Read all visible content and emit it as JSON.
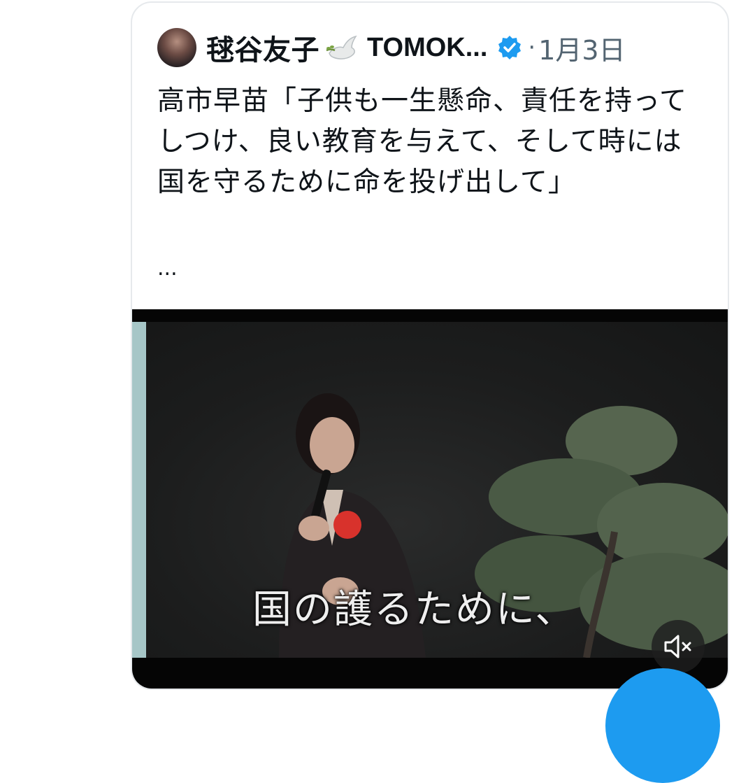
{
  "tweet": {
    "author_name": "毬谷友子",
    "handle_name": "TOMOK...",
    "separator": "·",
    "date": "1月3日",
    "text": "高市早苗「子供も一生懸命、責任を持ってしつけ、良い教育を与えて、そして時には国を守るために命を投げ出して」",
    "ellipsis": "...",
    "media": {
      "subtitle": "国の護るために、",
      "mute_icon": "speaker-muted-icon"
    }
  },
  "icons": {
    "dove": "dove-icon",
    "verified": "verified-badge-icon"
  },
  "colors": {
    "verified_blue": "#1d9bf0",
    "secondary_text": "#536471",
    "fab_blue": "#1d9bf0"
  }
}
